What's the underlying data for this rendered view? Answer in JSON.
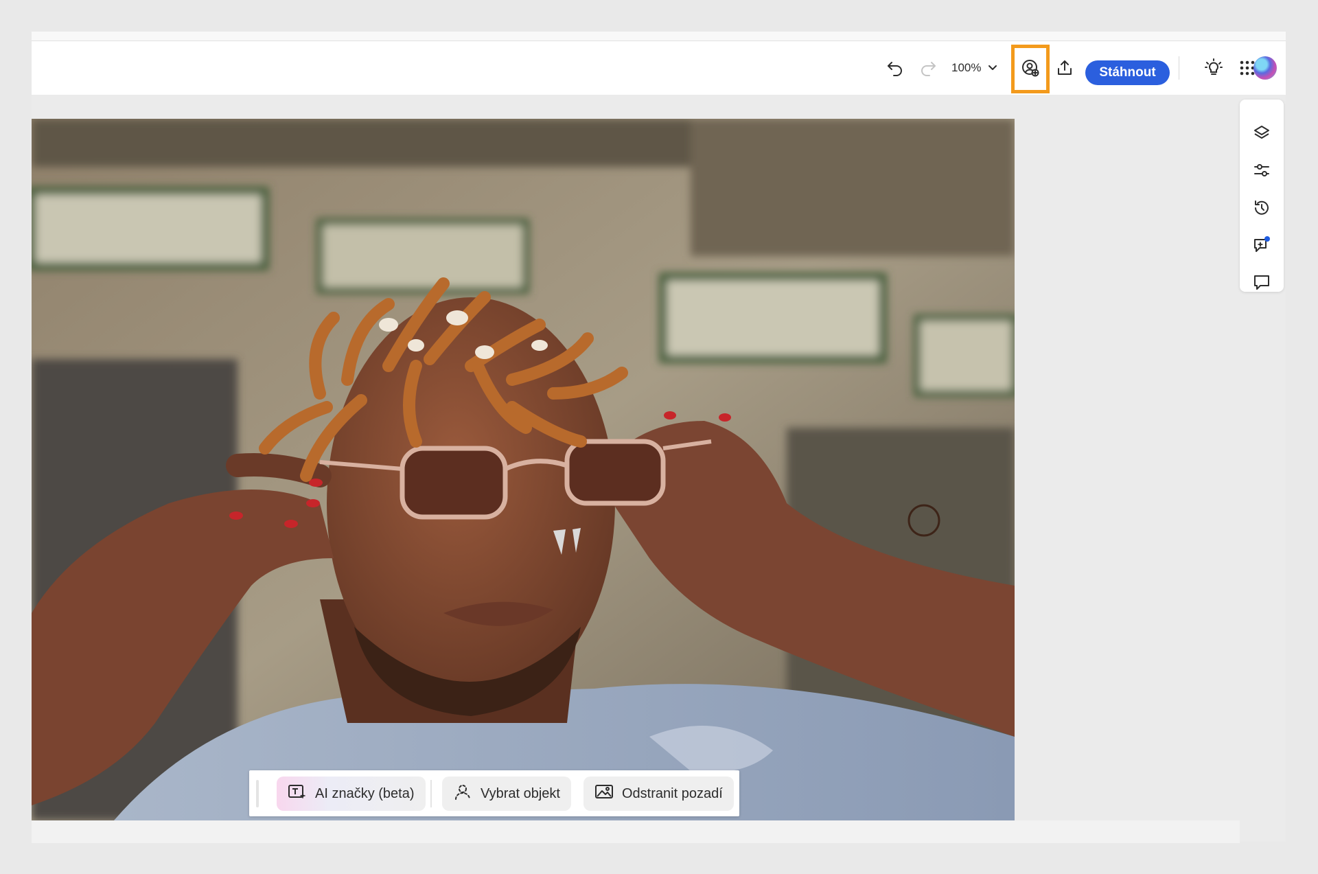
{
  "toolbar": {
    "zoom_level": "100%",
    "download_label": "Stáhnout",
    "icons": {
      "undo": "undo-icon",
      "redo": "redo-icon",
      "zoom_dropdown": "chevron-down-icon",
      "highlighted": "user-badge-add-icon",
      "share": "upload-icon",
      "tips": "lightbulb-icon",
      "apps": "app-grid-icon",
      "avatar": "user-avatar"
    },
    "highlight_color": "#f39a1c",
    "accent_color": "#2b5fde"
  },
  "side_panel": {
    "icons": [
      "layers-icon",
      "adjustments-icon",
      "history-icon",
      "ai-assistant-icon",
      "comment-icon"
    ],
    "notification_color": "#1e5be0"
  },
  "quick_actions": {
    "ai_tags_label": "AI značky (beta)",
    "select_object_label": "Vybrat objekt",
    "remove_background_label": "Odstranit pozadí"
  }
}
